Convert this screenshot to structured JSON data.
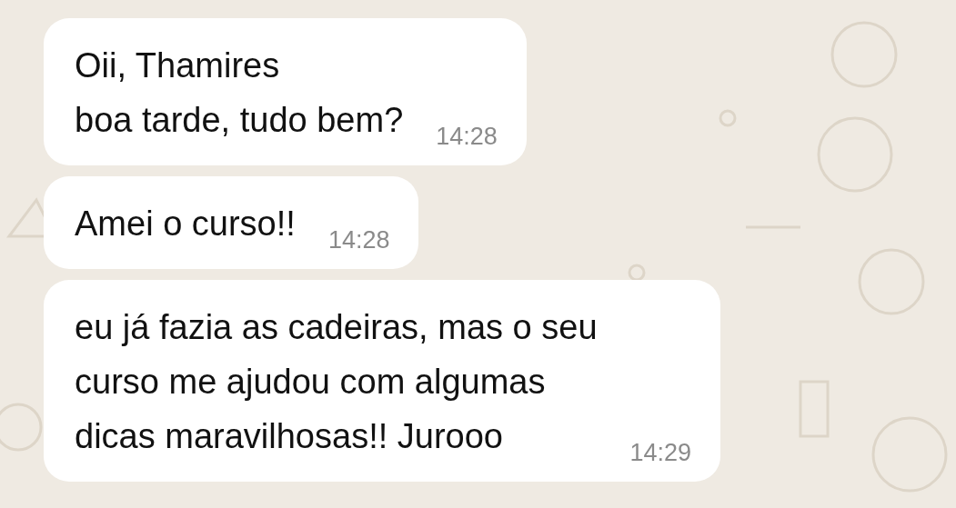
{
  "messages": [
    {
      "text": "Oii, Thamires\nboa tarde, tudo bem?",
      "time": "14:28"
    },
    {
      "text": "Amei o curso!!",
      "time": "14:28"
    },
    {
      "text": "eu já fazia as cadeiras, mas o seu\ncurso me ajudou com algumas\ndicas maravilhosas!! Jurooo",
      "time": "14:29"
    }
  ]
}
